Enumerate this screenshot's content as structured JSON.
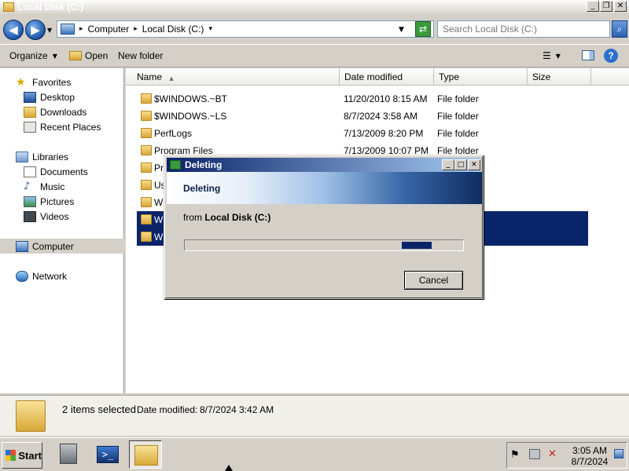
{
  "window": {
    "title": "Local Disk (C:)",
    "minimize_glyph": "_",
    "restore_glyph": "❐",
    "close_glyph": "✕"
  },
  "address": {
    "breadcrumbs": [
      "Computer",
      "Local Disk (C:)"
    ],
    "search_placeholder": "Search Local Disk (C:)"
  },
  "toolbar": {
    "organize": "Organize",
    "open": "Open",
    "new_folder": "New folder"
  },
  "nav": {
    "favorites": "Favorites",
    "desktop": "Desktop",
    "downloads": "Downloads",
    "recent": "Recent Places",
    "libraries": "Libraries",
    "documents": "Documents",
    "music": "Music",
    "pictures": "Pictures",
    "videos": "Videos",
    "computer": "Computer",
    "network": "Network"
  },
  "columns": {
    "name": "Name",
    "date": "Date modified",
    "type": "Type",
    "size": "Size"
  },
  "files": [
    {
      "name": "$WINDOWS.~BT",
      "date": "11/20/2010 8:15 AM",
      "type": "File folder"
    },
    {
      "name": "$WINDOWS.~LS",
      "date": "8/7/2024 3:58 AM",
      "type": "File folder"
    },
    {
      "name": "PerfLogs",
      "date": "7/13/2009 8:20 PM",
      "type": "File folder"
    },
    {
      "name": "Program Files",
      "date": "7/13/2009 10:07 PM",
      "type": "File folder"
    },
    {
      "name": "Pro",
      "date": "",
      "type": ""
    },
    {
      "name": "Us",
      "date": "",
      "type": ""
    },
    {
      "name": "Wi",
      "date": "",
      "type": ""
    },
    {
      "name": "Wi",
      "date": "",
      "type": ""
    },
    {
      "name": "Wi",
      "date": "",
      "type": ""
    }
  ],
  "details": {
    "selection": "2 items selected",
    "date_label": "Date modified:",
    "date_value": "8/7/2024 3:42 AM"
  },
  "dialog": {
    "title": "Deleting",
    "banner": "Deleting",
    "from_prefix": "from",
    "from_location": "Local Disk (C:)",
    "progress": 0.85,
    "cancel": "Cancel"
  },
  "taskbar": {
    "start": "Start",
    "time": "3:05 AM",
    "date": "8/7/2024"
  }
}
